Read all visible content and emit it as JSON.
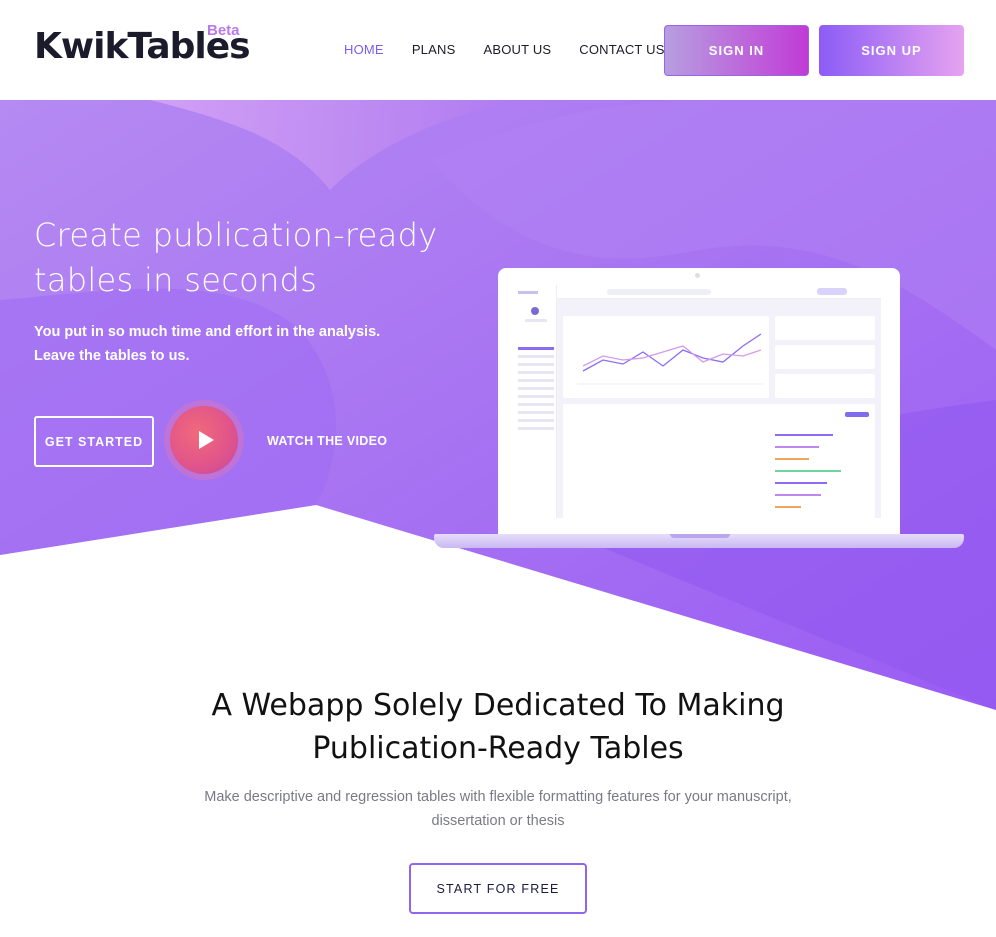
{
  "brand": {
    "name": "KwikTables",
    "badge": "Beta",
    "accent": "#7b5cf0"
  },
  "nav": [
    {
      "label": "HOME",
      "active": true
    },
    {
      "label": "PLANS",
      "active": false
    },
    {
      "label": "ABOUT US",
      "active": false
    },
    {
      "label": "CONTACT US",
      "active": false
    }
  ],
  "auth": {
    "signin_label": "SIGN IN",
    "signup_label": "SIGN UP"
  },
  "hero": {
    "title_line1": "Create publication-ready",
    "title_line2": "tables in seconds",
    "subtitle_line1": "You put in so much time and effort in the analysis.",
    "subtitle_line2": "Leave the tables to us.",
    "cta_label": "GET STARTED",
    "video_label": "WATCH THE VIDEO",
    "colors": {
      "primary": "#9c6cf5",
      "secondary": "#c38af0",
      "play": "#e2558a"
    }
  },
  "feature": {
    "title_line1": "A Webapp Solely Dedicated To Making",
    "title_line2": "Publication-Ready Tables",
    "description_line1": "Make descriptive and regression tables with flexible formatting features for your manuscript,",
    "description_line2": "dissertation or thesis",
    "cta_label": "START FOR FREE"
  }
}
